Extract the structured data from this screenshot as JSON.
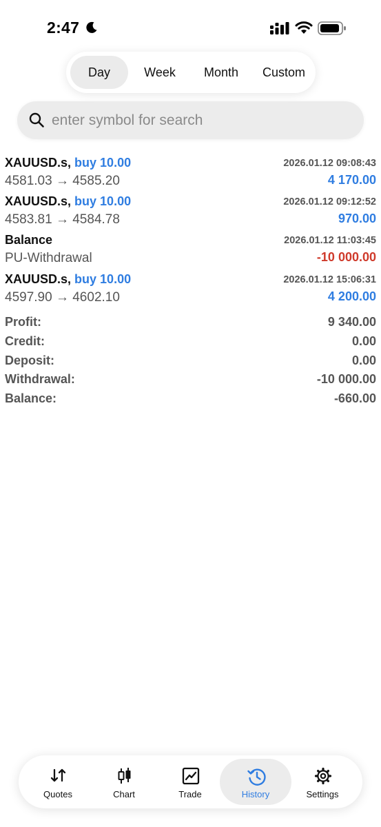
{
  "status": {
    "time": "2:47"
  },
  "periods": [
    {
      "label": "Day",
      "active": true
    },
    {
      "label": "Week",
      "active": false
    },
    {
      "label": "Month",
      "active": false
    },
    {
      "label": "Custom",
      "active": false
    }
  ],
  "search": {
    "placeholder": "enter symbol for search",
    "value": ""
  },
  "deals": [
    {
      "title": "XAUUSD.s,",
      "action": "buy 10.00",
      "detail": "4581.03 → 4585.20",
      "date": "2026.01.12 09:08:43",
      "profit": "4 170.00"
    },
    {
      "title": "XAUUSD.s,",
      "action": "buy 10.00",
      "detail": "4583.81 → 4584.78",
      "date": "2026.01.12 09:12:52",
      "profit": "970.00"
    },
    {
      "title": "Balance",
      "action": "",
      "detail": "PU-Withdrawal",
      "date": "2026.01.12 11:03:45",
      "profit": "-10 000.00"
    },
    {
      "title": "XAUUSD.s,",
      "action": "buy 10.00",
      "detail": "4597.90 → 4602.10",
      "date": "2026.01.12 15:06:31",
      "profit": "4 200.00"
    }
  ],
  "summary": [
    {
      "label": "Profit:",
      "value": "9 340.00"
    },
    {
      "label": "Credit:",
      "value": "0.00"
    },
    {
      "label": "Deposit:",
      "value": "0.00"
    },
    {
      "label": "Withdrawal:",
      "value": "-10 000.00"
    },
    {
      "label": "Balance:",
      "value": "-660.00"
    }
  ],
  "tabs": [
    {
      "label": "Quotes",
      "icon": "quotes-arrows-icon",
      "active": false
    },
    {
      "label": "Chart",
      "icon": "candlestick-icon",
      "active": false
    },
    {
      "label": "Trade",
      "icon": "trade-chart-icon",
      "active": false
    },
    {
      "label": "History",
      "icon": "history-clock-icon",
      "active": true
    },
    {
      "label": "Settings",
      "icon": "gear-icon",
      "active": false
    }
  ],
  "colors": {
    "accent": "#2f7de1",
    "negative": "#cf3a2b",
    "muted": "#555555"
  }
}
